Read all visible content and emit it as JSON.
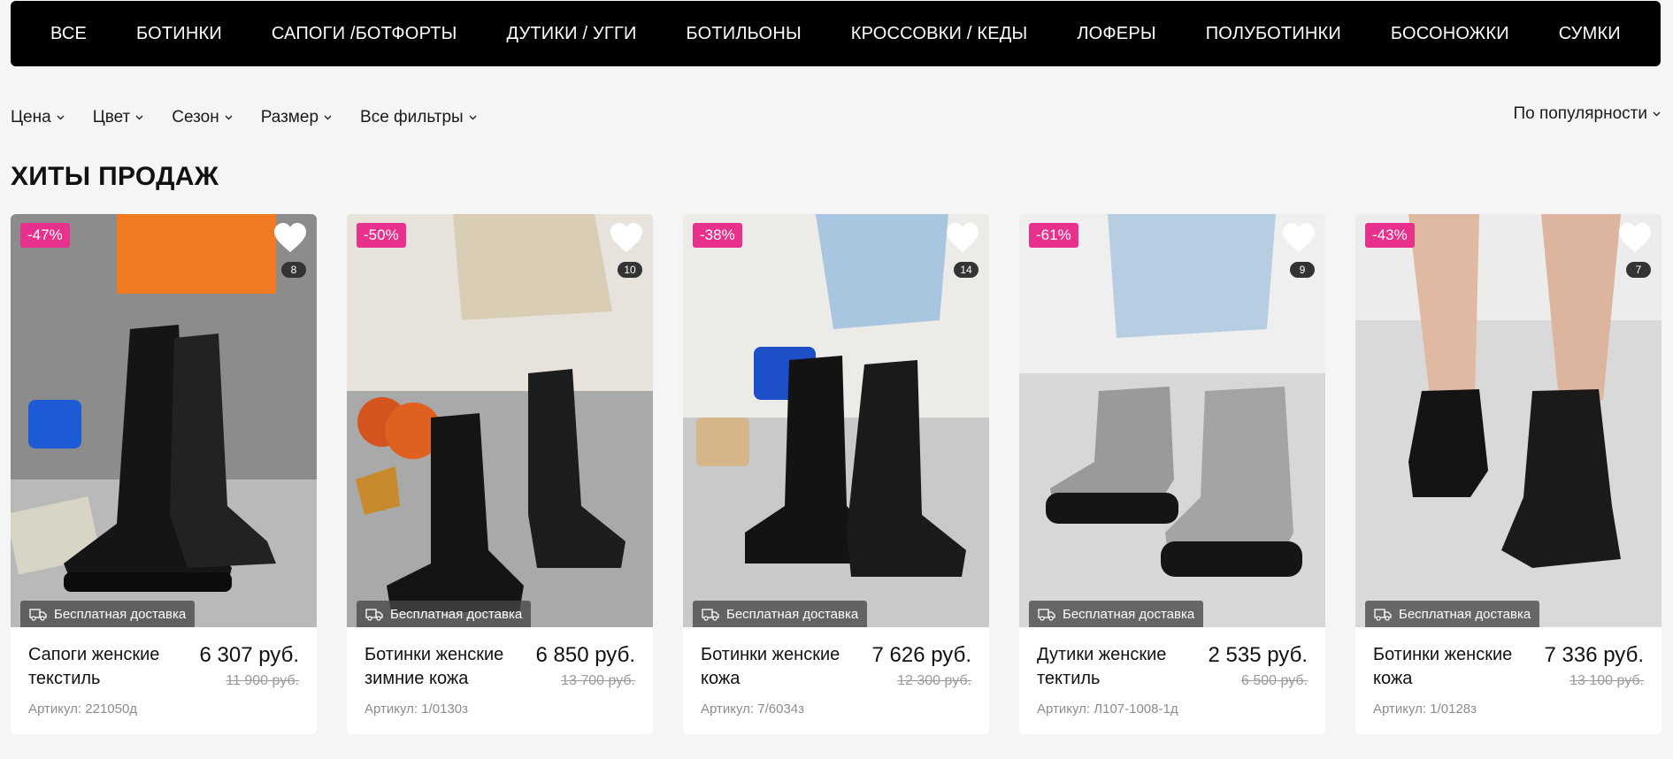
{
  "nav": [
    "ВСЕ",
    "БОТИНКИ",
    "САПОГИ /БОТФОРТЫ",
    "ДУТИКИ / УГГИ",
    "БОТИЛЬОНЫ",
    "КРОССОВКИ / КЕДЫ",
    "ЛОФЕРЫ",
    "ПОЛУБОТИНКИ",
    "БОСОНОЖКИ",
    "СУМКИ"
  ],
  "filters": [
    "Цена",
    "Цвет",
    "Сезон",
    "Размер",
    "Все фильтры"
  ],
  "sort_label": "По популярности",
  "section_title": "ХИТЫ ПРОДАЖ",
  "delivery_label": "Бесплатная доставка",
  "sku_prefix": "Артикул:",
  "products": [
    {
      "discount": "-47%",
      "count": "8",
      "name": "Сапоги женские текстиль",
      "price": "6 307 руб.",
      "old_price": "11 900 руб.",
      "sku": "Артикул: 221050д"
    },
    {
      "discount": "-50%",
      "count": "10",
      "name": "Ботинки женские зимние кожа",
      "price": "6 850 руб.",
      "old_price": "13 700 руб.",
      "sku": "Артикул: 1/0130з"
    },
    {
      "discount": "-38%",
      "count": "14",
      "name": "Ботинки женские кожа",
      "price": "7 626 руб.",
      "old_price": "12 300 руб.",
      "sku": "Артикул: 7/6034з"
    },
    {
      "discount": "-61%",
      "count": "9",
      "name": "Дутики женские тектиль",
      "price": "2 535 руб.",
      "old_price": "6 500 руб.",
      "sku": "Артикул: Л107-1008-1д"
    },
    {
      "discount": "-43%",
      "count": "7",
      "name": "Ботинки женские кожа",
      "price": "7 336 руб.",
      "old_price": "13 100 руб.",
      "sku": "Артикул: 1/0128з"
    }
  ],
  "colors": {
    "accent": "#e8318c",
    "nav_bg": "#000000",
    "page_bg": "#f5f5f5"
  }
}
